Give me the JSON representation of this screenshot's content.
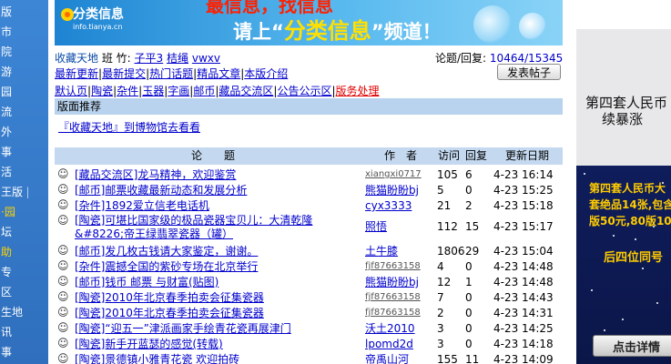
{
  "left_nav": [
    "版",
    "市",
    "院",
    "游",
    "园",
    "流",
    "外",
    "事",
    "活",
    "王版 ‖",
    "·园",
    "坛",
    "助",
    "专",
    "区",
    "生地",
    "讯",
    "事"
  ],
  "banner": {
    "logo_text": "分类信息",
    "logo_sub": "info.tianya.cn",
    "top_text": "最信息，找信息",
    "main_prefix": "请上“",
    "main_highlight": "分类信息",
    "main_suffix": "”频道！"
  },
  "forum": {
    "title": "收藏天地",
    "moderators_label": "班 竹:",
    "moderators": [
      "子平3",
      "桔绳",
      "vwxv"
    ],
    "stats_label": "论题/回复:",
    "stats_value": "10464/153457",
    "post_button": "发表帖子",
    "tabs_row1": [
      "最新更新",
      "最新提交",
      "热门话题",
      "精品文章",
      "本版介绍"
    ],
    "tabs_row2": [
      "默认页",
      "陶瓷",
      "杂件",
      "玉器",
      "字画",
      "邮币",
      "藏品交流区",
      "公告公示区"
    ],
    "tabs_row2_red": "版务处理",
    "notice_label": "版面推荐",
    "notice_link": "『收藏天地』到博物馆去看看"
  },
  "table": {
    "headers": {
      "title": "论　　题",
      "author": "作　者",
      "reads": "访问",
      "replies": "回复",
      "date": "更新日期"
    },
    "rows": [
      {
        "title": "[藏品交流区]龙马精神，欢迎鉴赏",
        "author": "xiangxi0717",
        "reads": "105",
        "replies": "6",
        "date": "4-23 16:14"
      },
      {
        "title": "[邮币]邮票收藏最新动态和发展分析",
        "author": "熊猫盼盼bj",
        "reads": "5",
        "replies": "0",
        "date": "4-23 15:25"
      },
      {
        "title": "[杂件]1892爱立信老电话机",
        "author": "cyx3333",
        "reads": "21",
        "replies": "2",
        "date": "4-23 15:18"
      },
      {
        "title": "[陶瓷]可堪比国家级的极品瓷器宝贝儿：大清乾隆&#8226;帝王绿翡翠瓷器（罐）",
        "author": "照悟",
        "reads": "112",
        "replies": "15",
        "date": "4-23 15:17"
      },
      {
        "title": "[邮币]发几枚古钱请大家鉴定，谢谢。",
        "author": "土牛膝",
        "reads": "1806",
        "replies": "29",
        "date": "4-23 15:04"
      },
      {
        "title": "[杂件]震撼全国的紫砂专场在北京举行",
        "author": "fjf87663158",
        "reads": "4",
        "replies": "0",
        "date": "4-23 14:48"
      },
      {
        "title": "[邮币]钱币 邮票 与财富(贴图)",
        "author": "熊猫盼盼bj",
        "reads": "12",
        "replies": "1",
        "date": "4-23 14:48"
      },
      {
        "title": "[陶瓷]2010年北京春季拍卖会征集瓷器",
        "author": "fjf87663158",
        "reads": "7",
        "replies": "0",
        "date": "4-23 14:43"
      },
      {
        "title": "[陶瓷]2010年北京春季拍卖会征集瓷器",
        "author": "fjf87663158",
        "reads": "2",
        "replies": "0",
        "date": "4-23 14:31"
      },
      {
        "title": "[陶瓷]“迎五一”津派画家手绘青花瓷再展津门",
        "author": "沃土2010",
        "reads": "3",
        "replies": "0",
        "date": "4-23 14:25"
      },
      {
        "title": "[陶瓷]新手开蓝瑟的感觉(转载)",
        "author": "lpomd2d",
        "reads": "3",
        "replies": "0",
        "date": "4-23 14:18"
      },
      {
        "title": "[陶瓷]景德镇小雅青花瓷 欢迎拍砖",
        "author": "帝禹山河",
        "reads": "155",
        "replies": "11",
        "date": "4-23 14:09"
      }
    ]
  },
  "ad": {
    "headline1": "第四套人民币",
    "headline2": "续暴涨",
    "line1": "第四套人民币大",
    "line2": "套绝品14张,包含",
    "line3": "版50元,80版10",
    "footer": "后四位同号",
    "button": "点击详情"
  }
}
